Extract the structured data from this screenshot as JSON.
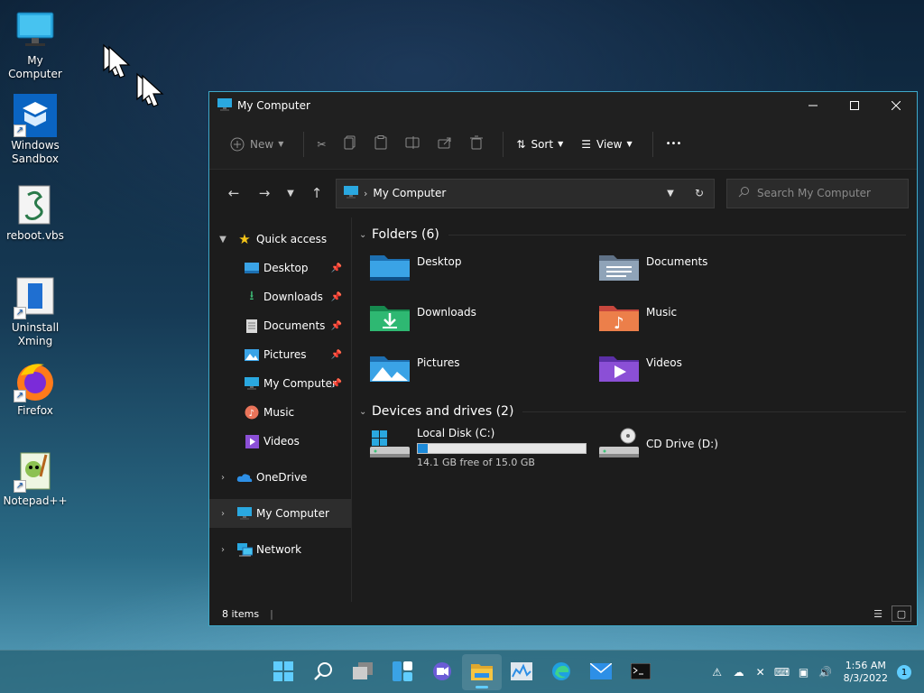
{
  "desktop": {
    "icons": [
      {
        "label": "My Computer"
      },
      {
        "label": "Windows\nSandbox"
      },
      {
        "label": "reboot.vbs"
      },
      {
        "label": "Uninstall\nXming"
      },
      {
        "label": "Firefox"
      },
      {
        "label": "Notepad++"
      }
    ]
  },
  "window": {
    "title": "My Computer",
    "toolbar": {
      "new_label": "New",
      "sort_label": "Sort",
      "view_label": "View",
      "more_label": "•••"
    },
    "address": {
      "path": "My Computer",
      "search_placeholder": "Search My Computer"
    },
    "nav": {
      "quick_access": "Quick access",
      "quick_items": [
        {
          "label": "Desktop",
          "pinned": true
        },
        {
          "label": "Downloads",
          "pinned": true
        },
        {
          "label": "Documents",
          "pinned": true
        },
        {
          "label": "Pictures",
          "pinned": true
        },
        {
          "label": "My Computer",
          "pinned": true
        },
        {
          "label": "Music",
          "pinned": false
        },
        {
          "label": "Videos",
          "pinned": false
        }
      ],
      "onedrive": "OneDrive",
      "my_computer": "My Computer",
      "network": "Network"
    },
    "main": {
      "folders_header": "Folders (6)",
      "folders": [
        {
          "name": "Desktop"
        },
        {
          "name": "Documents"
        },
        {
          "name": "Downloads"
        },
        {
          "name": "Music"
        },
        {
          "name": "Pictures"
        },
        {
          "name": "Videos"
        }
      ],
      "devices_header": "Devices and drives (2)",
      "drives": [
        {
          "name": "Local Disk (C:)",
          "free_text": "14.1 GB free of 15.0 GB",
          "used_fraction": 0.06
        },
        {
          "name": "CD Drive (D:)"
        }
      ]
    },
    "status": {
      "items_text": "8 items"
    }
  },
  "taskbar": {
    "apps": [
      "start-icon",
      "search-icon",
      "task-view-icon",
      "widgets-icon",
      "chat-icon",
      "file-explorer-icon",
      "task-manager-icon",
      "edge-icon",
      "mail-icon",
      "terminal-icon"
    ],
    "clock_time": "1:56 AM",
    "clock_date": "8/3/2022",
    "notification_count": "1"
  },
  "colors": {
    "accent": "#60cdff",
    "window_border": "#3fa9c9",
    "window_bg": "#1c1c1c",
    "drive_bar_fill": "#1c8ad9"
  }
}
